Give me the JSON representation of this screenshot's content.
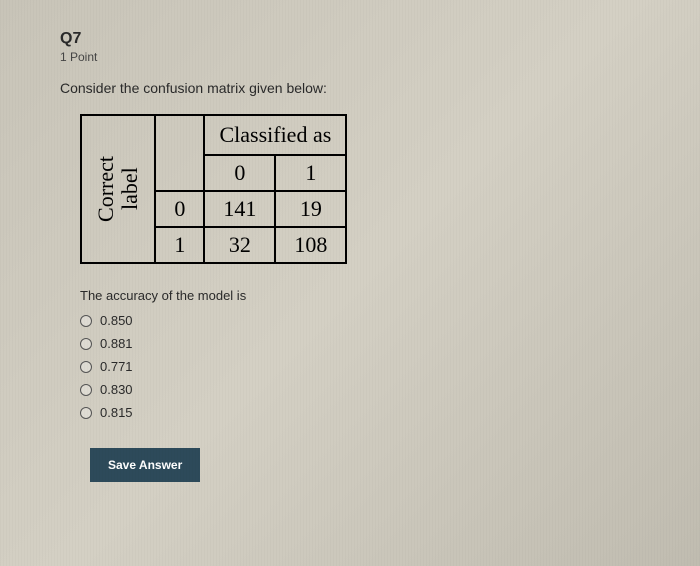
{
  "question": {
    "number": "Q7",
    "points": "1 Point",
    "prompt": "Consider the confusion matrix given below:",
    "sub_prompt": "The accuracy of the model is"
  },
  "matrix": {
    "ylabel": "Correct\nlabel",
    "header_top": "Classified as",
    "col_headers": [
      "0",
      "1"
    ],
    "row_headers": [
      "0",
      "1"
    ],
    "cells": [
      [
        "141",
        "19"
      ],
      [
        "32",
        "108"
      ]
    ]
  },
  "options": [
    "0.850",
    "0.881",
    "0.771",
    "0.830",
    "0.815"
  ],
  "buttons": {
    "save": "Save Answer"
  }
}
